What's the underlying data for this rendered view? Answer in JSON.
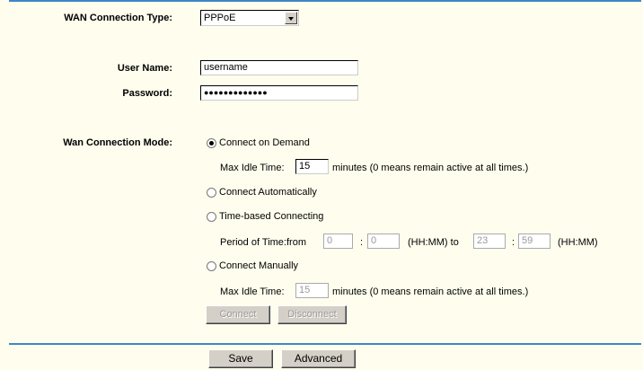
{
  "wan_type": {
    "label": "WAN Connection Type:",
    "selected": "PPPoE"
  },
  "user_name": {
    "label": "User Name:",
    "value": "username"
  },
  "password": {
    "label": "Password:",
    "value": "●●●●●●●●●●●●●"
  },
  "mode": {
    "label": "Wan Connection Mode:",
    "connect_on_demand": "Connect on Demand",
    "demand_idle_label": "Max Idle Time:",
    "demand_idle_value": "15",
    "demand_idle_note": "minutes (0 means remain active at all times.)",
    "connect_auto": "Connect Automatically",
    "time_based": "Time-based Connecting",
    "period_label": "Period of Time:from",
    "from_hh": "0",
    "from_mm": "0",
    "colon": ":",
    "hhmm_to": "(HH:MM) to",
    "to_hh": "23",
    "to_mm": "59",
    "hhmm": "(HH:MM)",
    "connect_manually": "Connect Manually",
    "manual_idle_label": "Max Idle Time:",
    "manual_idle_value": "15",
    "manual_idle_note": "minutes (0 means remain active at all times.)",
    "selected": "connect_on_demand"
  },
  "buttons": {
    "connect": "Connect",
    "disconnect": "Disconnect",
    "save": "Save",
    "advanced": "Advanced"
  },
  "colors": {
    "background": "#fffeee",
    "divider": "#3f86c8"
  }
}
